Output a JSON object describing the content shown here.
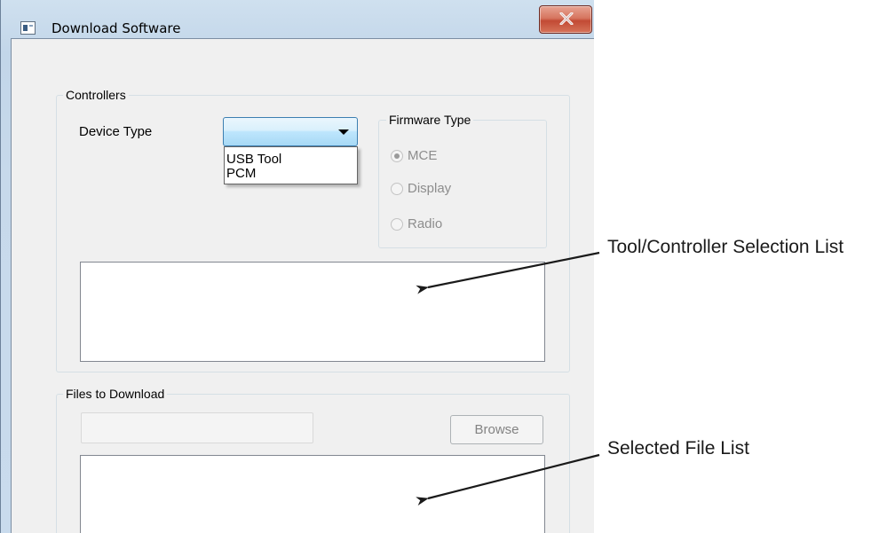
{
  "window": {
    "title": "Download Software",
    "close_glyph": "x"
  },
  "controllers": {
    "group_label": "Controllers",
    "device_type_label": "Device Type",
    "device_type_value": "",
    "dropdown_options": [
      "USB Tool",
      "PCM"
    ],
    "firmware": {
      "group_label": "Firmware Type",
      "options": [
        {
          "label": "MCE",
          "checked": true
        },
        {
          "label": "Display",
          "checked": false
        },
        {
          "label": "Radio",
          "checked": false
        }
      ]
    }
  },
  "files": {
    "group_label": "Files to Download",
    "path_value": "",
    "browse_label": "Browse"
  },
  "annotations": {
    "selection_list": "Tool/Controller Selection List",
    "file_list": "Selected File List"
  },
  "colors": {
    "combo_border": "#3c7fb1",
    "close_button": "#c24a34",
    "disabled_text": "#8d8d8d"
  }
}
